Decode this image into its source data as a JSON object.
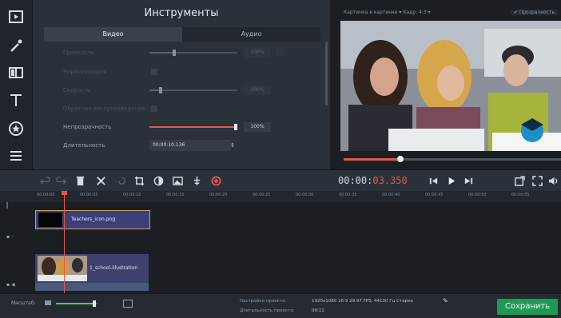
{
  "tools_panel": {
    "title": "Инструменты",
    "tabs": [
      {
        "label": "Видео",
        "active": true
      },
      {
        "label": "Аудио",
        "active": false
      }
    ],
    "properties": [
      {
        "label": "Громкость",
        "control": "slider",
        "enabled": false,
        "level": 0.28,
        "value": "100%"
      },
      {
        "label": "Нормализация",
        "control": "checkbox",
        "enabled": false
      },
      {
        "label": "Скорость",
        "control": "slider",
        "enabled": false,
        "level": 0.12,
        "value": "100%"
      },
      {
        "label": "Обратное воспроизведение",
        "control": "checkbox",
        "enabled": false
      },
      {
        "label": "Непрозрачность",
        "control": "slider",
        "enabled": true,
        "level": 1.0,
        "value": "100%"
      },
      {
        "label": "Длительность",
        "control": "time",
        "enabled": true,
        "value": "00:00:10.136"
      }
    ]
  },
  "preview": {
    "toolbar_text": "Картинка в картинке  ▾   Кадр: 4:3  ▾",
    "toolbar_right": "✔ Прозрачность",
    "seek_progress": 0.26
  },
  "toolbar": {
    "timecode_main": "00:00:",
    "timecode_red": "03.350"
  },
  "ruler": {
    "ticks": [
      "00:00:00",
      "00:00:05",
      "00:00:10",
      "00:00:15",
      "00:00:20",
      "00:00:25",
      "00:00:30",
      "00:00:35",
      "00:00:40",
      "00:00:45",
      "00:00:50",
      "00:00:55"
    ]
  },
  "timeline": {
    "clips": [
      {
        "name": "Teachers_icon.png",
        "kind": "image"
      },
      {
        "name": "1_school-illustration",
        "kind": "video"
      }
    ]
  },
  "status": {
    "scale_label": "Масштаб:",
    "scale_level": 0.92,
    "project_settings_label": "Настройки проекта:",
    "project_settings_value": "1920x1080 16:9 29.97 FPS, 44100 Гц Стерео",
    "project_duration_label": "Длительность проекта:",
    "project_duration_value": "00:11",
    "save_label": "Сохранить"
  },
  "colors": {
    "accent": "#e6564f",
    "save": "#1f9a52",
    "panel": "#2b3139"
  }
}
